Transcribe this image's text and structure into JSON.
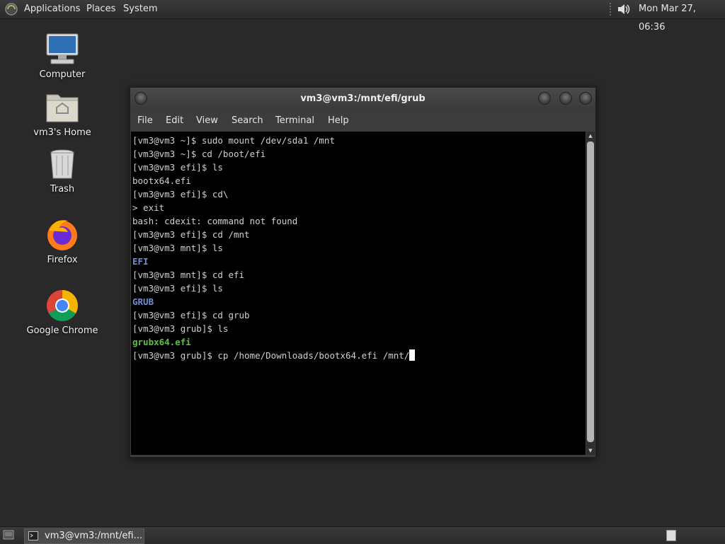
{
  "top_panel": {
    "menus": [
      "Applications",
      "Places",
      "System"
    ],
    "clock": "Mon Mar 27, 06:36"
  },
  "desktop": {
    "icons": [
      {
        "label": "Computer",
        "icon": "computer-icon"
      },
      {
        "label": "vm3's Home",
        "icon": "home-folder-icon"
      },
      {
        "label": "Trash",
        "icon": "trash-icon"
      },
      {
        "label": "Firefox",
        "icon": "firefox-icon"
      },
      {
        "label": "Google Chrome",
        "icon": "chrome-icon"
      }
    ]
  },
  "terminal": {
    "title": "vm3@vm3:/mnt/efi/grub",
    "menus": [
      "File",
      "Edit",
      "View",
      "Search",
      "Terminal",
      "Help"
    ],
    "lines": [
      {
        "text": "[vm3@vm3 ~]$ sudo mount /dev/sda1 /mnt",
        "color": "default"
      },
      {
        "text": "[vm3@vm3 ~]$ cd /boot/efi",
        "color": "default"
      },
      {
        "text": "[vm3@vm3 efi]$ ls",
        "color": "default"
      },
      {
        "text": "bootx64.efi",
        "color": "default"
      },
      {
        "text": "[vm3@vm3 efi]$ cd\\",
        "color": "default"
      },
      {
        "text": "> exit",
        "color": "default"
      },
      {
        "text": "bash: cdexit: command not found",
        "color": "default"
      },
      {
        "text": "[vm3@vm3 efi]$ cd /mnt",
        "color": "default"
      },
      {
        "text": "[vm3@vm3 mnt]$ ls",
        "color": "default"
      },
      {
        "text": "EFI",
        "color": "blue"
      },
      {
        "text": "[vm3@vm3 mnt]$ cd efi",
        "color": "default"
      },
      {
        "text": "[vm3@vm3 efi]$ ls",
        "color": "default"
      },
      {
        "text": "GRUB",
        "color": "blue"
      },
      {
        "text": "[vm3@vm3 efi]$ cd grub",
        "color": "default"
      },
      {
        "text": "[vm3@vm3 grub]$ ls",
        "color": "default"
      },
      {
        "text": "grubx64.efi",
        "color": "green"
      },
      {
        "text": "[vm3@vm3 grub]$ cp /home/Downloads/bootx64.efi /mnt/",
        "color": "default"
      }
    ]
  },
  "taskbar": {
    "task_label": "vm3@vm3:/mnt/efi..."
  },
  "colors": {
    "desktop_bg": "#292929",
    "terminal_bg": "#000000",
    "dir_blue": "#6f8fd0",
    "exec_green": "#5cc23e"
  }
}
